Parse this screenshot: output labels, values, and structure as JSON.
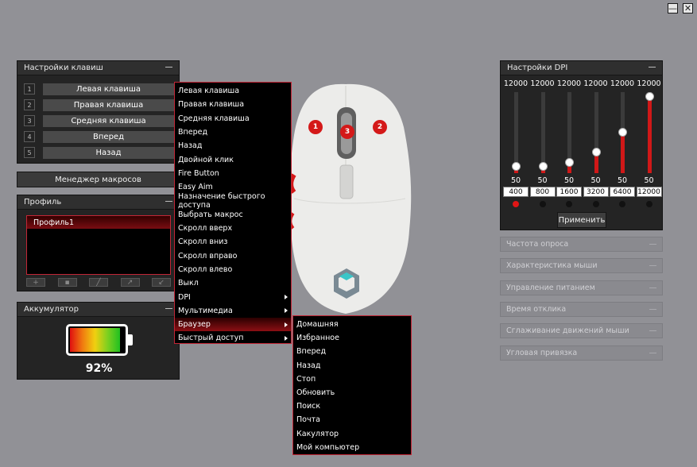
{
  "window": {
    "minimize_glyph": "—",
    "close_glyph": "✕"
  },
  "keys": {
    "title": "Настройки клавиш",
    "rows": [
      {
        "num": "1",
        "label": "Левая клавиша"
      },
      {
        "num": "2",
        "label": "Правая клавиша"
      },
      {
        "num": "3",
        "label": "Средняя клавиша"
      },
      {
        "num": "4",
        "label": "Вперед"
      },
      {
        "num": "5",
        "label": "Назад"
      }
    ]
  },
  "macro": {
    "label": "Менеджер макросов"
  },
  "profile": {
    "title": "Профиль",
    "items": [
      "Профиль1"
    ]
  },
  "battery": {
    "title": "Аккумулятор",
    "percent_text": "92%",
    "level": 0.92
  },
  "context_menu": {
    "items": [
      {
        "label": "Левая клавиша",
        "submenu": false
      },
      {
        "label": "Правая клавиша",
        "submenu": false
      },
      {
        "label": "Средняя клавиша",
        "submenu": false
      },
      {
        "label": "Вперед",
        "submenu": false
      },
      {
        "label": "Назад",
        "submenu": false
      },
      {
        "label": "Двойной клик",
        "submenu": false
      },
      {
        "label": "Fire Button",
        "submenu": false
      },
      {
        "label": "Easy Aim",
        "submenu": false
      },
      {
        "label": "Назначение быстрого доступа",
        "submenu": false
      },
      {
        "label": "Выбрать макрос",
        "submenu": false
      },
      {
        "label": "Скролл вверх",
        "submenu": false
      },
      {
        "label": "Скролл вниз",
        "submenu": false
      },
      {
        "label": "Скролл вправо",
        "submenu": false
      },
      {
        "label": "Скролл влево",
        "submenu": false
      },
      {
        "label": "Выкл",
        "submenu": false
      },
      {
        "label": "DPI",
        "submenu": true
      },
      {
        "label": "Мультимедиа",
        "submenu": true
      },
      {
        "label": "Браузер",
        "submenu": true,
        "selected": true
      },
      {
        "label": "Быстрый доступ",
        "submenu": true
      }
    ]
  },
  "submenu": {
    "items": [
      "Домашняя",
      "Избранное",
      "Вперед",
      "Назад",
      "Стоп",
      "Обновить",
      "Поиск",
      "Почта",
      "Какулятор",
      "Мой компьютер"
    ]
  },
  "mouse": {
    "badges": [
      "1",
      "2",
      "3"
    ]
  },
  "dpi": {
    "title": "Настройки DPI",
    "max_labels": [
      "12000",
      "12000",
      "12000",
      "12000",
      "12000",
      "12000"
    ],
    "levels": [
      "50",
      "50",
      "50",
      "50",
      "50",
      "50"
    ],
    "values": [
      "400",
      "800",
      "1600",
      "3200",
      "6400",
      "12000"
    ],
    "numeric": [
      400,
      800,
      1600,
      3200,
      6400,
      12000
    ],
    "max": 12000,
    "active_index": 0,
    "apply_label": "Применить"
  },
  "right_bars": [
    "Частота опроса",
    "Характеристика мыши",
    "Управление питанием",
    "Время отклика",
    "Сглаживание движений мыши",
    "Угловая привязка"
  ],
  "colors": {
    "accent": "#d01818",
    "panel": "#242424",
    "background": "#919196"
  }
}
